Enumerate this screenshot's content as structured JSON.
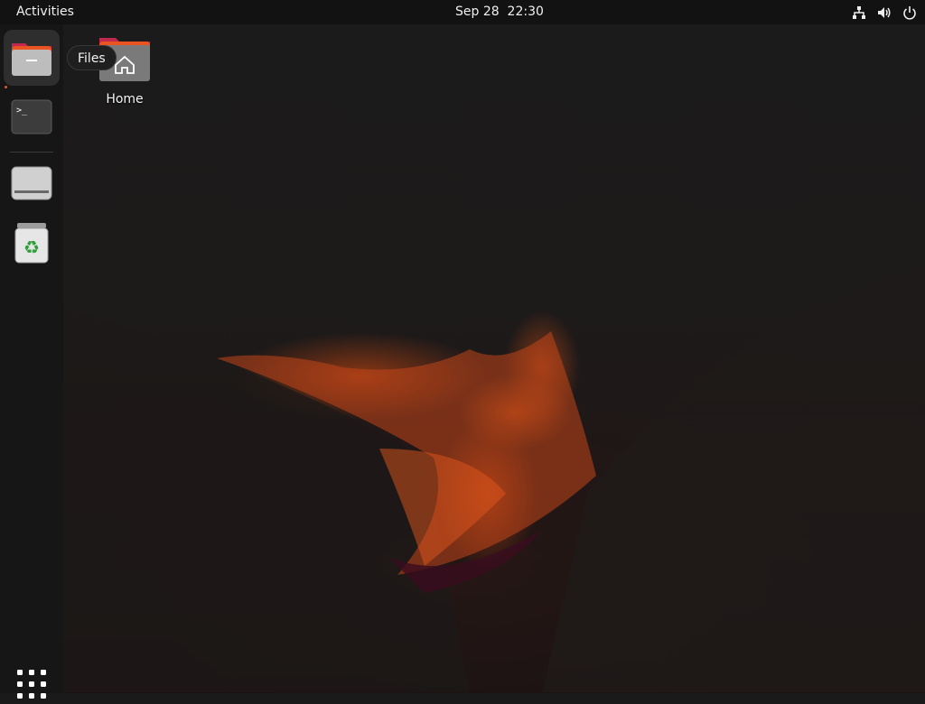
{
  "topbar": {
    "activities_label": "Activities",
    "clock": "Sep 28  22:30",
    "tray_icons": [
      "network-icon",
      "volume-icon",
      "power-icon"
    ]
  },
  "dock": {
    "items": [
      {
        "name": "Files",
        "icon": "files-icon",
        "active": true
      },
      {
        "name": "Terminal",
        "icon": "terminal-icon",
        "active": false
      },
      {
        "name": "Drive",
        "icon": "drive-icon",
        "active": false
      },
      {
        "name": "Trash",
        "icon": "trash-icon",
        "active": false
      }
    ],
    "apps_grid_icon": "show-apps-icon",
    "tooltip": "Files"
  },
  "desktop": {
    "icons": [
      {
        "label": "Home",
        "icon": "home-folder-icon"
      }
    ]
  },
  "colors": {
    "accent": "#e95420",
    "topbar_bg": "#121212",
    "dock_bg": "#161616"
  }
}
